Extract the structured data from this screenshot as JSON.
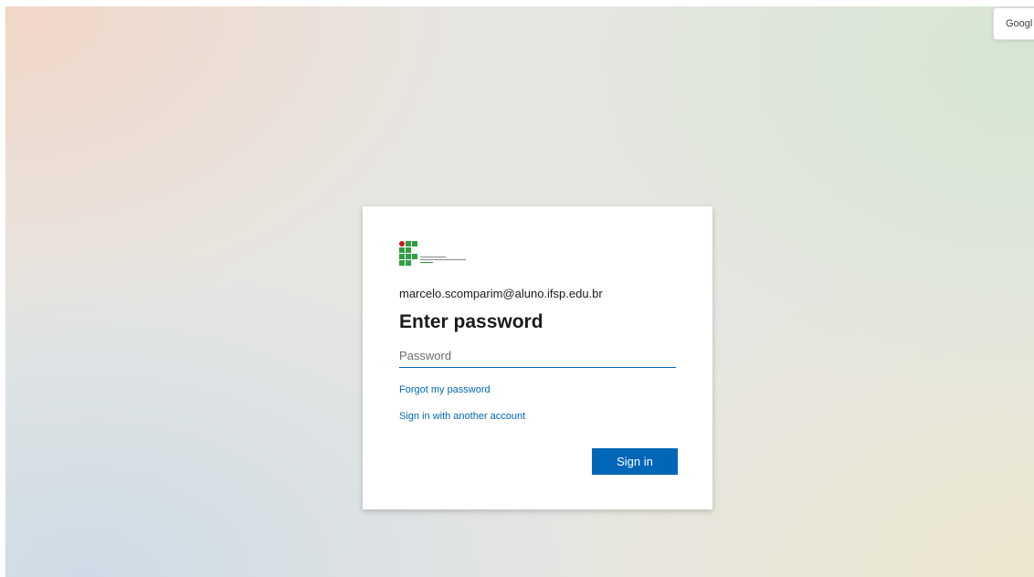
{
  "side_tab": {
    "label": "Googl"
  },
  "signin": {
    "identity": "marcelo.scomparim@aluno.ifsp.edu.br",
    "title": "Enter password",
    "password_placeholder": "Password",
    "password_value": "",
    "forgot_link": "Forgot my password",
    "another_account_link": "Sign in with another account",
    "submit_label": "Sign in"
  },
  "colors": {
    "accent": "#0067b8",
    "logo_green": "#2f9e41",
    "logo_red": "#cd191e"
  },
  "icons": {
    "logo": "ifsp-institution-logo"
  }
}
